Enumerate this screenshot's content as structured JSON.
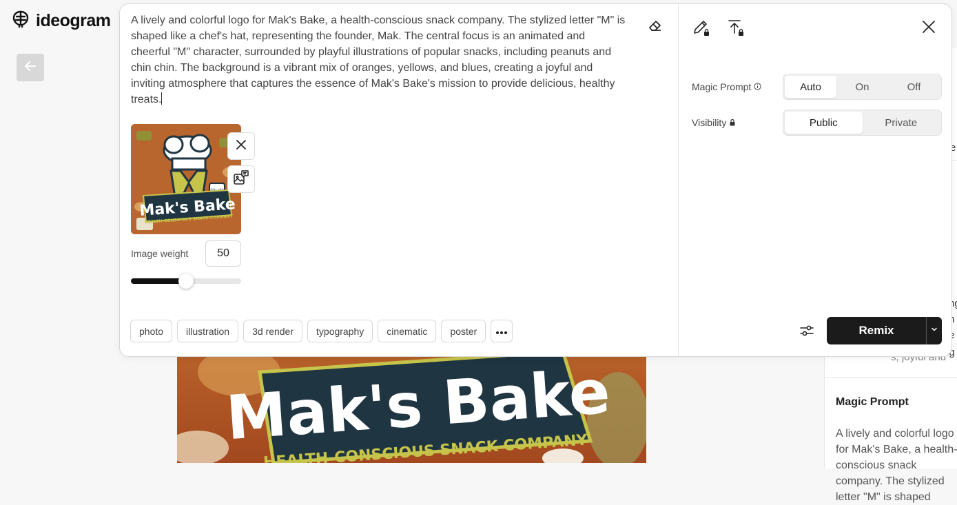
{
  "app": {
    "name": "ideogram"
  },
  "prompt": {
    "lines": [
      "A lively and colorful logo for Mak's Bake, a health-conscious snack company. The stylized letter \"M\" is",
      "shaped like a chef's hat, representing the founder, Mak. The central focus is an animated and",
      "cheerful \"M\" character, surrounded by playful illustrations of popular snacks, including peanuts and",
      "chin chin. The background is a vibrant mix of oranges, yellows, and blues, creating a joyful and",
      "inviting atmosphere that captures the essence of Mak's Bake's mission to provide delicious, healthy",
      "treats."
    ]
  },
  "reference_image": {
    "title": "Mak's Bake",
    "tagline": "HEALTH-CONSCIOUS SNACK COMPANY",
    "sticker_text": "chin chin"
  },
  "image_weight": {
    "label": "Image weight",
    "value": "50",
    "fraction": 0.5
  },
  "style_chips": [
    "photo",
    "illustration",
    "3d render",
    "typography",
    "cinematic",
    "poster"
  ],
  "options": {
    "magic_prompt": {
      "label": "Magic Prompt",
      "choices": [
        "Auto",
        "On",
        "Off"
      ],
      "selected": "Auto"
    },
    "visibility": {
      "label": "Visibility",
      "choices": [
        "Public",
        "Private"
      ],
      "selected": "Public"
    }
  },
  "remix_label": "Remix",
  "background_image": {
    "title": "Mak's Bake",
    "tagline": "HEALTH-CONSCIOUS SNACK COMPANY"
  },
  "side_panel": {
    "fragments": [
      "e",
      "ng",
      "n",
      "e",
      "ng t",
      "s, joyful and"
    ],
    "magic_prompt_title": "Magic Prompt",
    "magic_prompt_text": "A lively and colorful logo for Mak's Bake, a health-conscious snack company. The stylized letter \"M\" is shaped"
  },
  "colors": {
    "primary_button": "#1b1b1b",
    "accent_dark": "#1f3542",
    "accent_orange": "#b8632a"
  }
}
